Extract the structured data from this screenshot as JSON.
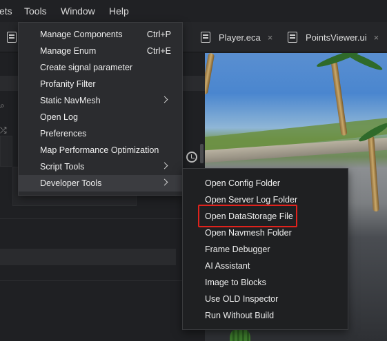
{
  "menubar": {
    "items": [
      "ets",
      "Tools",
      "Window",
      "Help"
    ]
  },
  "tabs": [
    {
      "label": "Player.eca",
      "close": "×"
    },
    {
      "label": "PointsViewer.ui",
      "close": "×"
    }
  ],
  "tools_menu": {
    "items": [
      {
        "label": "Manage Components",
        "shortcut": "Ctrl+P"
      },
      {
        "label": "Manage Enum",
        "shortcut": "Ctrl+E"
      },
      {
        "label": "Create signal parameter",
        "shortcut": ""
      },
      {
        "label": "Profanity Filter",
        "shortcut": ""
      },
      {
        "label": "Static NavMesh",
        "shortcut": ""
      },
      {
        "label": "Open Log",
        "shortcut": ""
      },
      {
        "label": "Preferences",
        "shortcut": ""
      },
      {
        "label": "Map Performance Optimization",
        "shortcut": ""
      },
      {
        "label": "Script Tools",
        "shortcut": ""
      },
      {
        "label": "Developer Tools",
        "shortcut": ""
      }
    ]
  },
  "developer_tools_submenu": {
    "items": [
      "Open Config Folder",
      "Open Server Log Folder",
      "Open DataStorage File",
      "Open Navmesh Folder",
      "Frame Debugger",
      "AI Assistant",
      "Image to Blocks",
      "Use OLD Inspector",
      "Run Without Build"
    ],
    "highlighted": "Open DataStorage File",
    "highlight_color": "#e0221c"
  },
  "colors": {
    "menu_bg": "#2b2c2f",
    "submenu_bg": "#1f2022",
    "active_item_bg": "#3b3c40",
    "text": "#efefef"
  },
  "icons": [
    "script-file-icon",
    "ui-file-icon",
    "history-icon",
    "chevron-right-icon",
    "close-icon"
  ]
}
